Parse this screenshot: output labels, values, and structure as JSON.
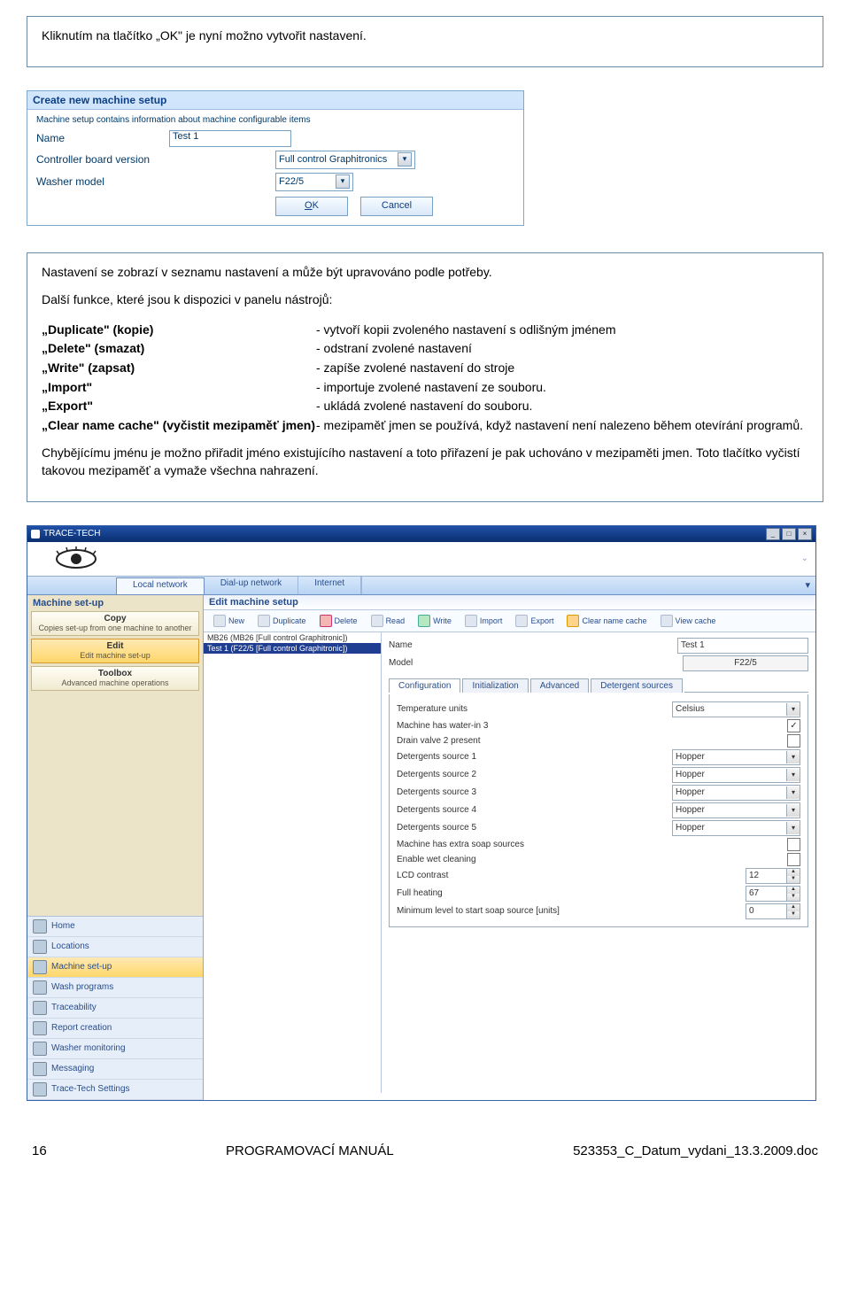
{
  "box1": {
    "text": "Kliknutím na tlačítko „OK\" je nyní možno vytvořit nastavení."
  },
  "dialog": {
    "title": "Create new machine setup",
    "subtitle": "Machine setup contains information about machine configurable items",
    "name_label": "Name",
    "name_value": "Test 1",
    "cbv_label": "Controller board version",
    "cbv_value": "Full control Graphitronics",
    "wm_label": "Washer model",
    "wm_value": "F22/5",
    "ok": "OK",
    "cancel": "Cancel"
  },
  "box2": {
    "intro1": "Nastavení se zobrazí v seznamu nastavení a může být upravováno podle potřeby.",
    "intro2": "Další funkce, které jsou k dispozici v panelu nástrojů:",
    "items": [
      {
        "l": "„Duplicate\" (kopie)",
        "r": "- vytvoří kopii zvoleného nastavení s odlišným jménem"
      },
      {
        "l": "„Delete\" (smazat)",
        "r": "- odstraní zvolené nastavení"
      },
      {
        "l": "„Write\" (zapsat)",
        "r": "- zapíše zvolené nastavení do stroje"
      },
      {
        "l": "„Import\"",
        "r": "- importuje zvolené nastavení ze souboru."
      },
      {
        "l": "„Export\"",
        "r": "- ukládá zvolené nastavení do souboru."
      },
      {
        "l": "„Clear name cache\" (vyčistit mezipaměť jmen)",
        "r": "- mezipaměť jmen se používá, když nastavení není nalezeno během otevírání programů."
      }
    ],
    "outro": "Chybějícímu jménu je možno přiřadit jméno existujícího nastavení a toto přiřazení je pak uchováno v mezipaměti jmen. Toto tlačítko vyčistí takovou mezipaměť a vymaže všechna nahrazení."
  },
  "app": {
    "title": "TRACE-TECH",
    "net_tabs": [
      "Local network",
      "Dial-up network",
      "Internet"
    ],
    "left_header": "Machine set-up",
    "sections": [
      {
        "t": "Copy",
        "s": "Copies set-up from one machine to another"
      },
      {
        "t": "Edit",
        "s": "Edit machine set-up"
      },
      {
        "t": "Toolbox",
        "s": "Advanced machine operations"
      }
    ],
    "bottom_nav": [
      "Home",
      "Locations",
      "Machine set-up",
      "Wash programs",
      "Traceability",
      "Report creation",
      "Washer monitoring",
      "Messaging",
      "Trace-Tech Settings"
    ],
    "r_header": "Edit machine setup",
    "toolbar": [
      "New",
      "Duplicate",
      "Delete",
      "Read",
      "Write",
      "Import",
      "Export",
      "Clear name cache",
      "View cache"
    ],
    "files": [
      "MB26 (MB26 [Full control Graphitronic])",
      "Test 1 (F22/5 [Full control Graphitronic])"
    ],
    "name_lab": "Name",
    "name_val": "Test 1",
    "model_lab": "Model",
    "model_val": "F22/5",
    "subtabs": [
      "Configuration",
      "Initialization",
      "Advanced",
      "Detergent sources"
    ],
    "cfg": [
      {
        "lab": "Temperature units",
        "type": "dd",
        "val": "Celsius"
      },
      {
        "lab": "Machine has water-in 3",
        "type": "chk",
        "val": true
      },
      {
        "lab": "Drain valve 2 present",
        "type": "chk",
        "val": false
      },
      {
        "lab": "Detergents source 1",
        "type": "dd",
        "val": "Hopper"
      },
      {
        "lab": "Detergents source 2",
        "type": "dd",
        "val": "Hopper"
      },
      {
        "lab": "Detergents source 3",
        "type": "dd",
        "val": "Hopper"
      },
      {
        "lab": "Detergents source 4",
        "type": "dd",
        "val": "Hopper"
      },
      {
        "lab": "Detergents source 5",
        "type": "dd",
        "val": "Hopper"
      },
      {
        "lab": "Machine has extra soap sources",
        "type": "chk",
        "val": false
      },
      {
        "lab": "Enable wet cleaning",
        "type": "chk",
        "val": false
      },
      {
        "lab": "LCD contrast",
        "type": "spin",
        "val": "12"
      },
      {
        "lab": "Full heating",
        "type": "spin",
        "val": "67"
      },
      {
        "lab": "Minimum level to start soap source [units]",
        "type": "spin",
        "val": "0"
      }
    ]
  },
  "footer": {
    "page": "16",
    "ctr": "PROGRAMOVACÍ MANUÁL",
    "right": "523353_C_Datum_vydani_13.3.2009.doc"
  }
}
